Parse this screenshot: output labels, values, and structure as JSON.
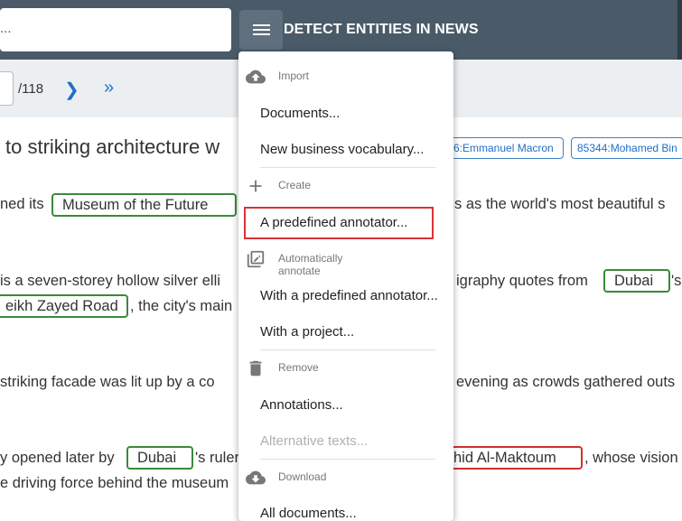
{
  "header": {
    "search_placeholder": "...",
    "title": "DETECT ENTITIES IN NEWS"
  },
  "pager": {
    "total": "/118"
  },
  "document": {
    "title": "to striking architecture w",
    "entity_chips": [
      "6:Emmanuel Macron",
      "85344:Mohamed Bin"
    ],
    "lines": {
      "l1a": "ned its",
      "l1b": "s as the world's most beautiful s",
      "l2a": "is a seven-storey hollow silver elli",
      "l2b": "igraphy quotes from",
      "l2c": "'s",
      "l3a": ", the city's main",
      "l4a": "striking facade was lit up by a co",
      "l4b": "evening as crowds gathered outs",
      "l5a": "y opened later by",
      "l5b": "'s ruler",
      "l5c": ", whose vision",
      "l6a": "e driving force behind the museum"
    },
    "entities": {
      "museum": "Museum of the Future",
      "dubai1": "Dubai",
      "zayed": "eikh Zayed Road",
      "dubai2": "Dubai",
      "maktoum": "hid Al-Maktoum"
    }
  },
  "menu": {
    "import_label": "Import",
    "documents": "Documents...",
    "new_vocab": "New business vocabulary...",
    "create_label": "Create",
    "predefined": "A predefined annotator...",
    "auto_label": "Automatically annotate",
    "with_predefined": "With a predefined annotator...",
    "with_project": "With a project...",
    "remove_label": "Remove",
    "annotations": "Annotations...",
    "alt_texts": "Alternative texts...",
    "download_label": "Download",
    "all_documents": "All documents..."
  }
}
